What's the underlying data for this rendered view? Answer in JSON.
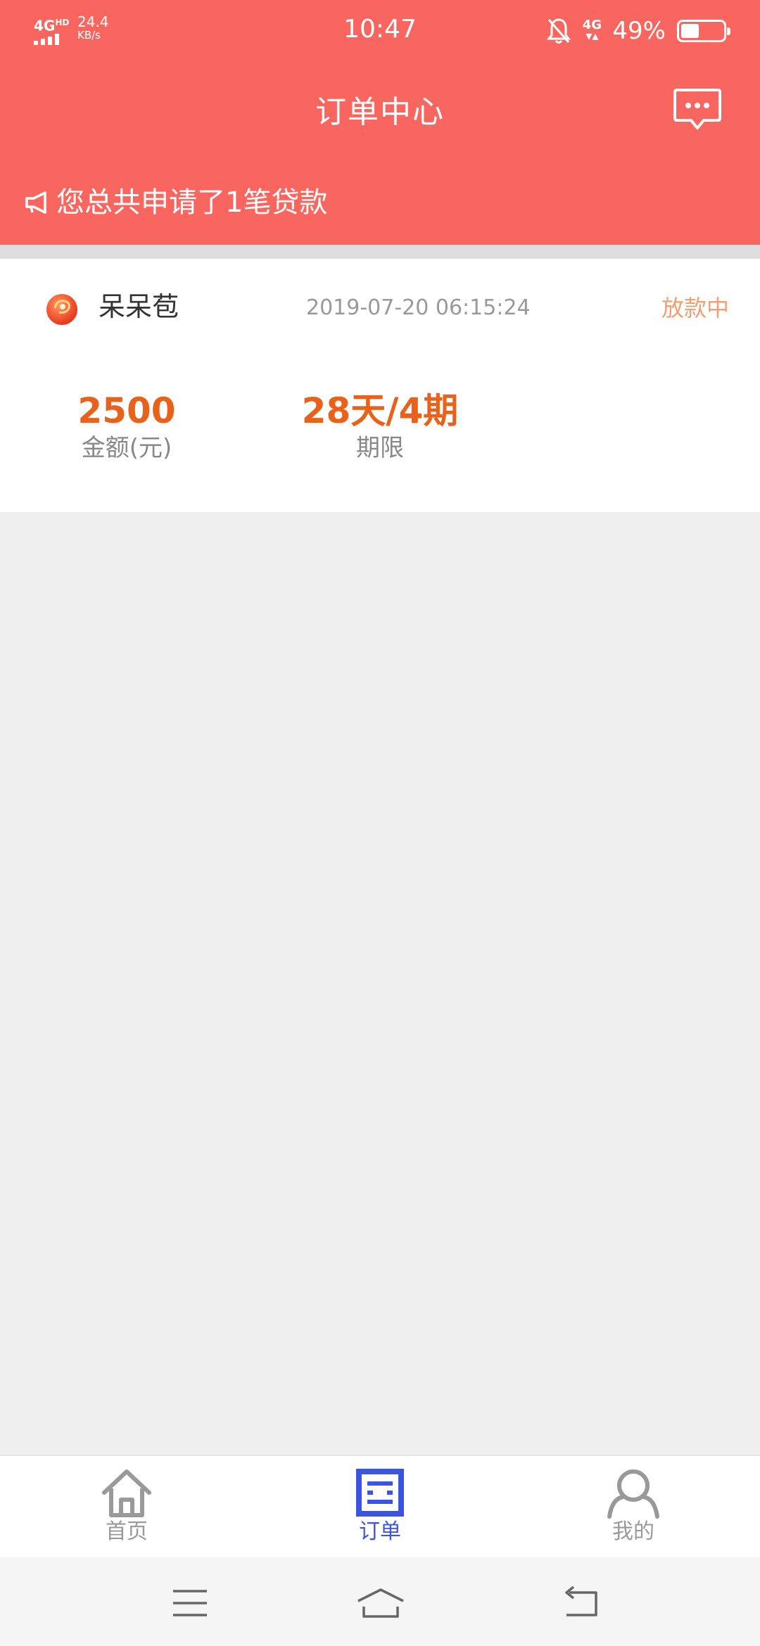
{
  "status_bar": {
    "network": "4G",
    "network_sup": "HD",
    "speed": "24.4",
    "speed_unit": "KB/s",
    "time": "10:47",
    "right_network": "4G",
    "battery_percent": "49%",
    "battery_level": 0.49
  },
  "header": {
    "title": "订单中心",
    "message_icon": "chat-bubble-icon",
    "notice_icon": "megaphone-icon",
    "notice_text": "您总共申请了1笔贷款"
  },
  "order": {
    "logo_icon": "app-logo-icon",
    "name": "呆呆苞",
    "time": "2019-07-20 06:15:24",
    "status": "放款中",
    "amount_value": "2500",
    "amount_label": "金额(元)",
    "term_value": "28天/4期",
    "term_label": "期限"
  },
  "tabs": [
    {
      "label": "首页",
      "icon": "home-icon",
      "active": false
    },
    {
      "label": "订单",
      "icon": "order-icon",
      "active": true
    },
    {
      "label": "我的",
      "icon": "user-icon",
      "active": false
    }
  ],
  "colors": {
    "header_bg": "#f96660",
    "accent_orange": "#e8621c",
    "status_orange": "#f0a070",
    "tab_active": "#3b55e0",
    "tab_inactive": "#999999"
  }
}
